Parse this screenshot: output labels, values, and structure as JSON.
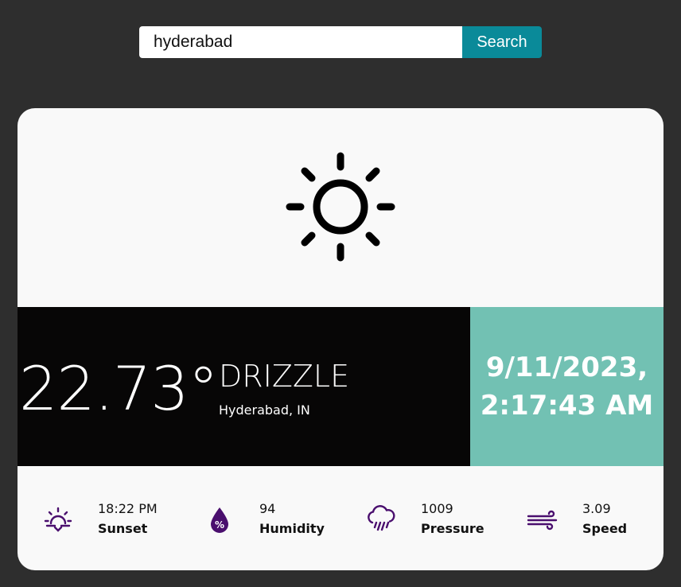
{
  "search": {
    "value": "hyderabad",
    "button_label": "Search"
  },
  "weather": {
    "icon": "sun-icon",
    "temperature": "22.73°",
    "condition": "DRIZZLE",
    "location": "Hyderabad, IN",
    "date": "9/11/2023,",
    "time": "2:17:43 AM"
  },
  "stats": [
    {
      "icon": "sunset-icon",
      "value": "18:22 PM",
      "label": "Sunset"
    },
    {
      "icon": "humidity-icon",
      "value": "94",
      "label": "Humidity"
    },
    {
      "icon": "pressure-icon",
      "value": "1009",
      "label": "Pressure"
    },
    {
      "icon": "wind-icon",
      "value": "3.09",
      "label": "Speed"
    }
  ],
  "colors": {
    "background": "#2e2e2e",
    "card": "#f9f9f9",
    "temp_band": "#070606",
    "date_band": "#72c1b3",
    "search_button": "#0a8a99",
    "stat_icon": "#4a0f6e"
  }
}
